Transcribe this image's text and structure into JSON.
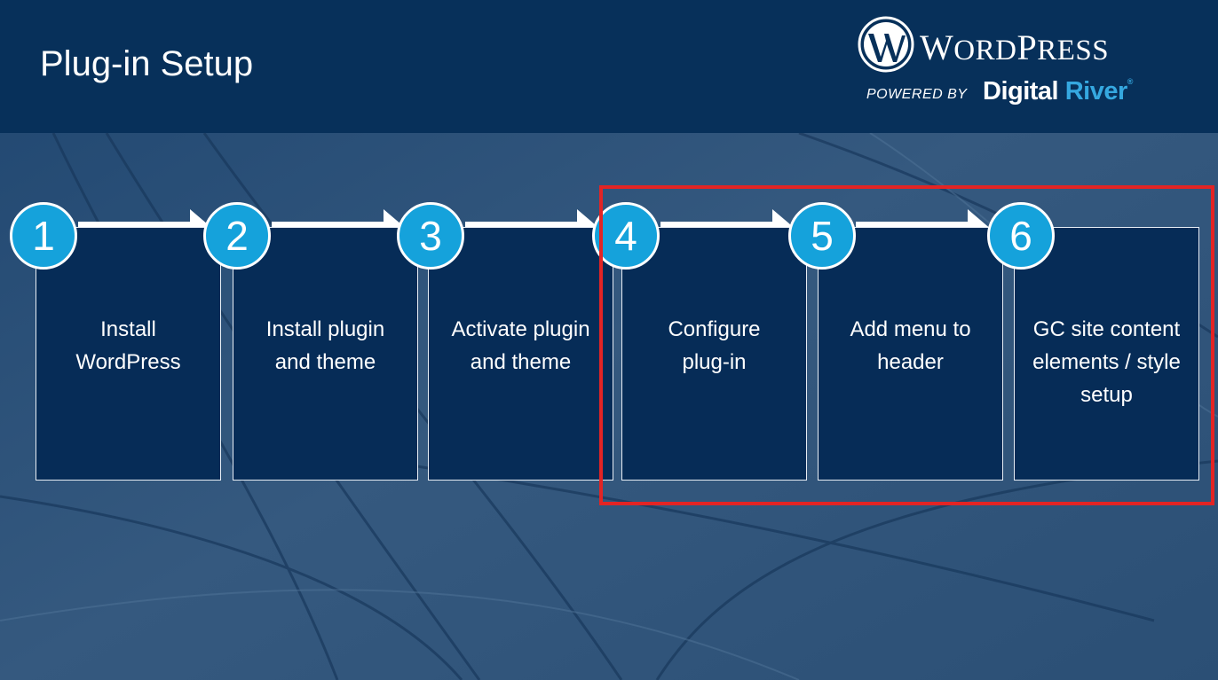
{
  "slide": {
    "title": "Plug-in Setup"
  },
  "branding": {
    "wordpress_first": "W",
    "wordpress_rest": "ORD",
    "wordpress_p": "P",
    "wordpress_tail": "RESS",
    "powered_by": "POWERED BY",
    "digital": "Digital",
    "river": "River",
    "registered": "®"
  },
  "steps": [
    {
      "number": "1",
      "line1": "Install",
      "line2": "WordPress",
      "line3": ""
    },
    {
      "number": "2",
      "line1": "Install plugin",
      "line2": "and theme",
      "line3": ""
    },
    {
      "number": "3",
      "line1": "Activate plugin",
      "line2": "and theme",
      "line3": ""
    },
    {
      "number": "4",
      "line1": "Configure",
      "line2": "plug-in",
      "line3": ""
    },
    {
      "number": "5",
      "line1": "Add menu to",
      "line2": "header",
      "line3": ""
    },
    {
      "number": "6",
      "line1": "GC site content",
      "line2": "elements / style",
      "line3": "setup"
    }
  ],
  "colors": {
    "header": "#07305a",
    "box": "#062c57",
    "circle": "#15a2db",
    "highlight": "#e32424"
  }
}
